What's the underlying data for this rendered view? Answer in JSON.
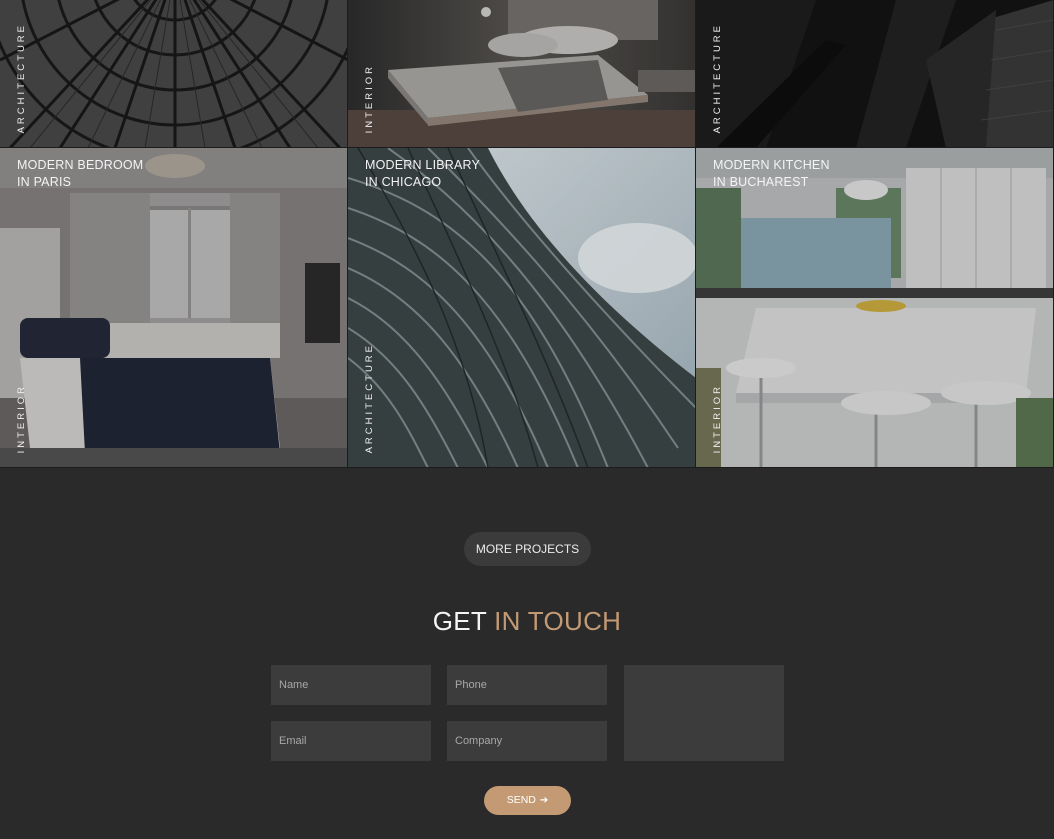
{
  "projects": [
    {
      "title_line1": "",
      "title_line2": "",
      "category": "Architecture",
      "image": "glass-dome-ceiling"
    },
    {
      "title_line1": "",
      "title_line2": "",
      "category": "Interior",
      "image": "low-platform-bedroom"
    },
    {
      "title_line1": "",
      "title_line2": "",
      "category": "Architecture",
      "image": "dark-skyscraper-facade"
    },
    {
      "title_line1": "Modern Bedroom",
      "title_line2": "in Paris",
      "category": "Interior",
      "image": "classic-bedroom"
    },
    {
      "title_line1": "Modern Library",
      "title_line2": "in Chicago",
      "category": "Architecture",
      "image": "curved-lattice-facade"
    },
    {
      "title_line1": "Modern Kitchen",
      "title_line2": "in Bucharest",
      "category": "Interior",
      "image": "white-kitchen"
    }
  ],
  "more_button": "More Projects",
  "contact": {
    "title_white": "GET",
    "title_accent": "IN TOUCH",
    "name_placeholder": "Name",
    "phone_placeholder": "Phone",
    "email_placeholder": "Email",
    "company_placeholder": "Company",
    "message_placeholder": "",
    "send_label": "Send",
    "send_icon": "arrow-right-icon"
  },
  "colors": {
    "background": "#2a2a2a",
    "accent": "#c39a74",
    "field": "#3c3c3c",
    "button": "#3b3b3b"
  }
}
